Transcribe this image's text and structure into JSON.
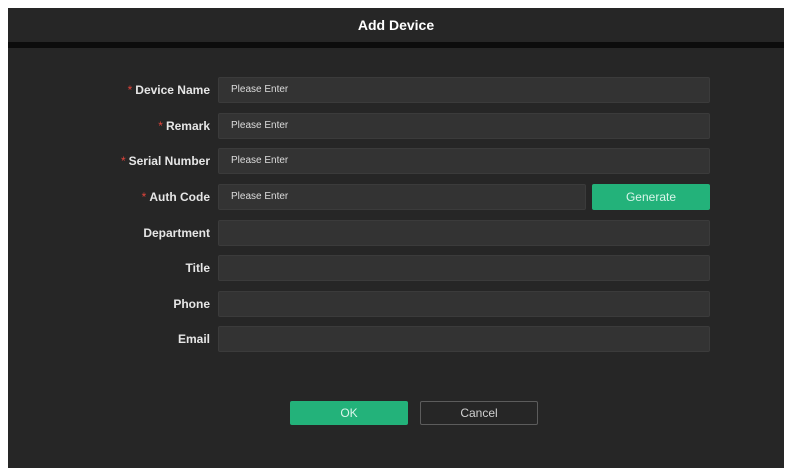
{
  "dialog": {
    "title": "Add Device"
  },
  "form": {
    "fields": [
      {
        "label": "Device Name",
        "required": true,
        "placeholder": "Please Enter",
        "value": ""
      },
      {
        "label": "Remark",
        "required": true,
        "placeholder": "Please Enter",
        "value": ""
      },
      {
        "label": "Serial Number",
        "required": true,
        "placeholder": "Please Enter",
        "value": ""
      },
      {
        "label": "Auth Code",
        "required": true,
        "placeholder": "Please Enter",
        "value": ""
      },
      {
        "label": "Department",
        "required": false,
        "placeholder": "",
        "value": ""
      },
      {
        "label": "Title",
        "required": false,
        "placeholder": "",
        "value": ""
      },
      {
        "label": "Phone",
        "required": false,
        "placeholder": "",
        "value": ""
      },
      {
        "label": "Email",
        "required": false,
        "placeholder": "",
        "value": ""
      }
    ],
    "required_mark": "*",
    "generate_label": "Generate"
  },
  "footer": {
    "ok_label": "OK",
    "cancel_label": "Cancel"
  },
  "colors": {
    "accent": "#23b27a",
    "required": "#e0443b",
    "background": "#262626"
  }
}
